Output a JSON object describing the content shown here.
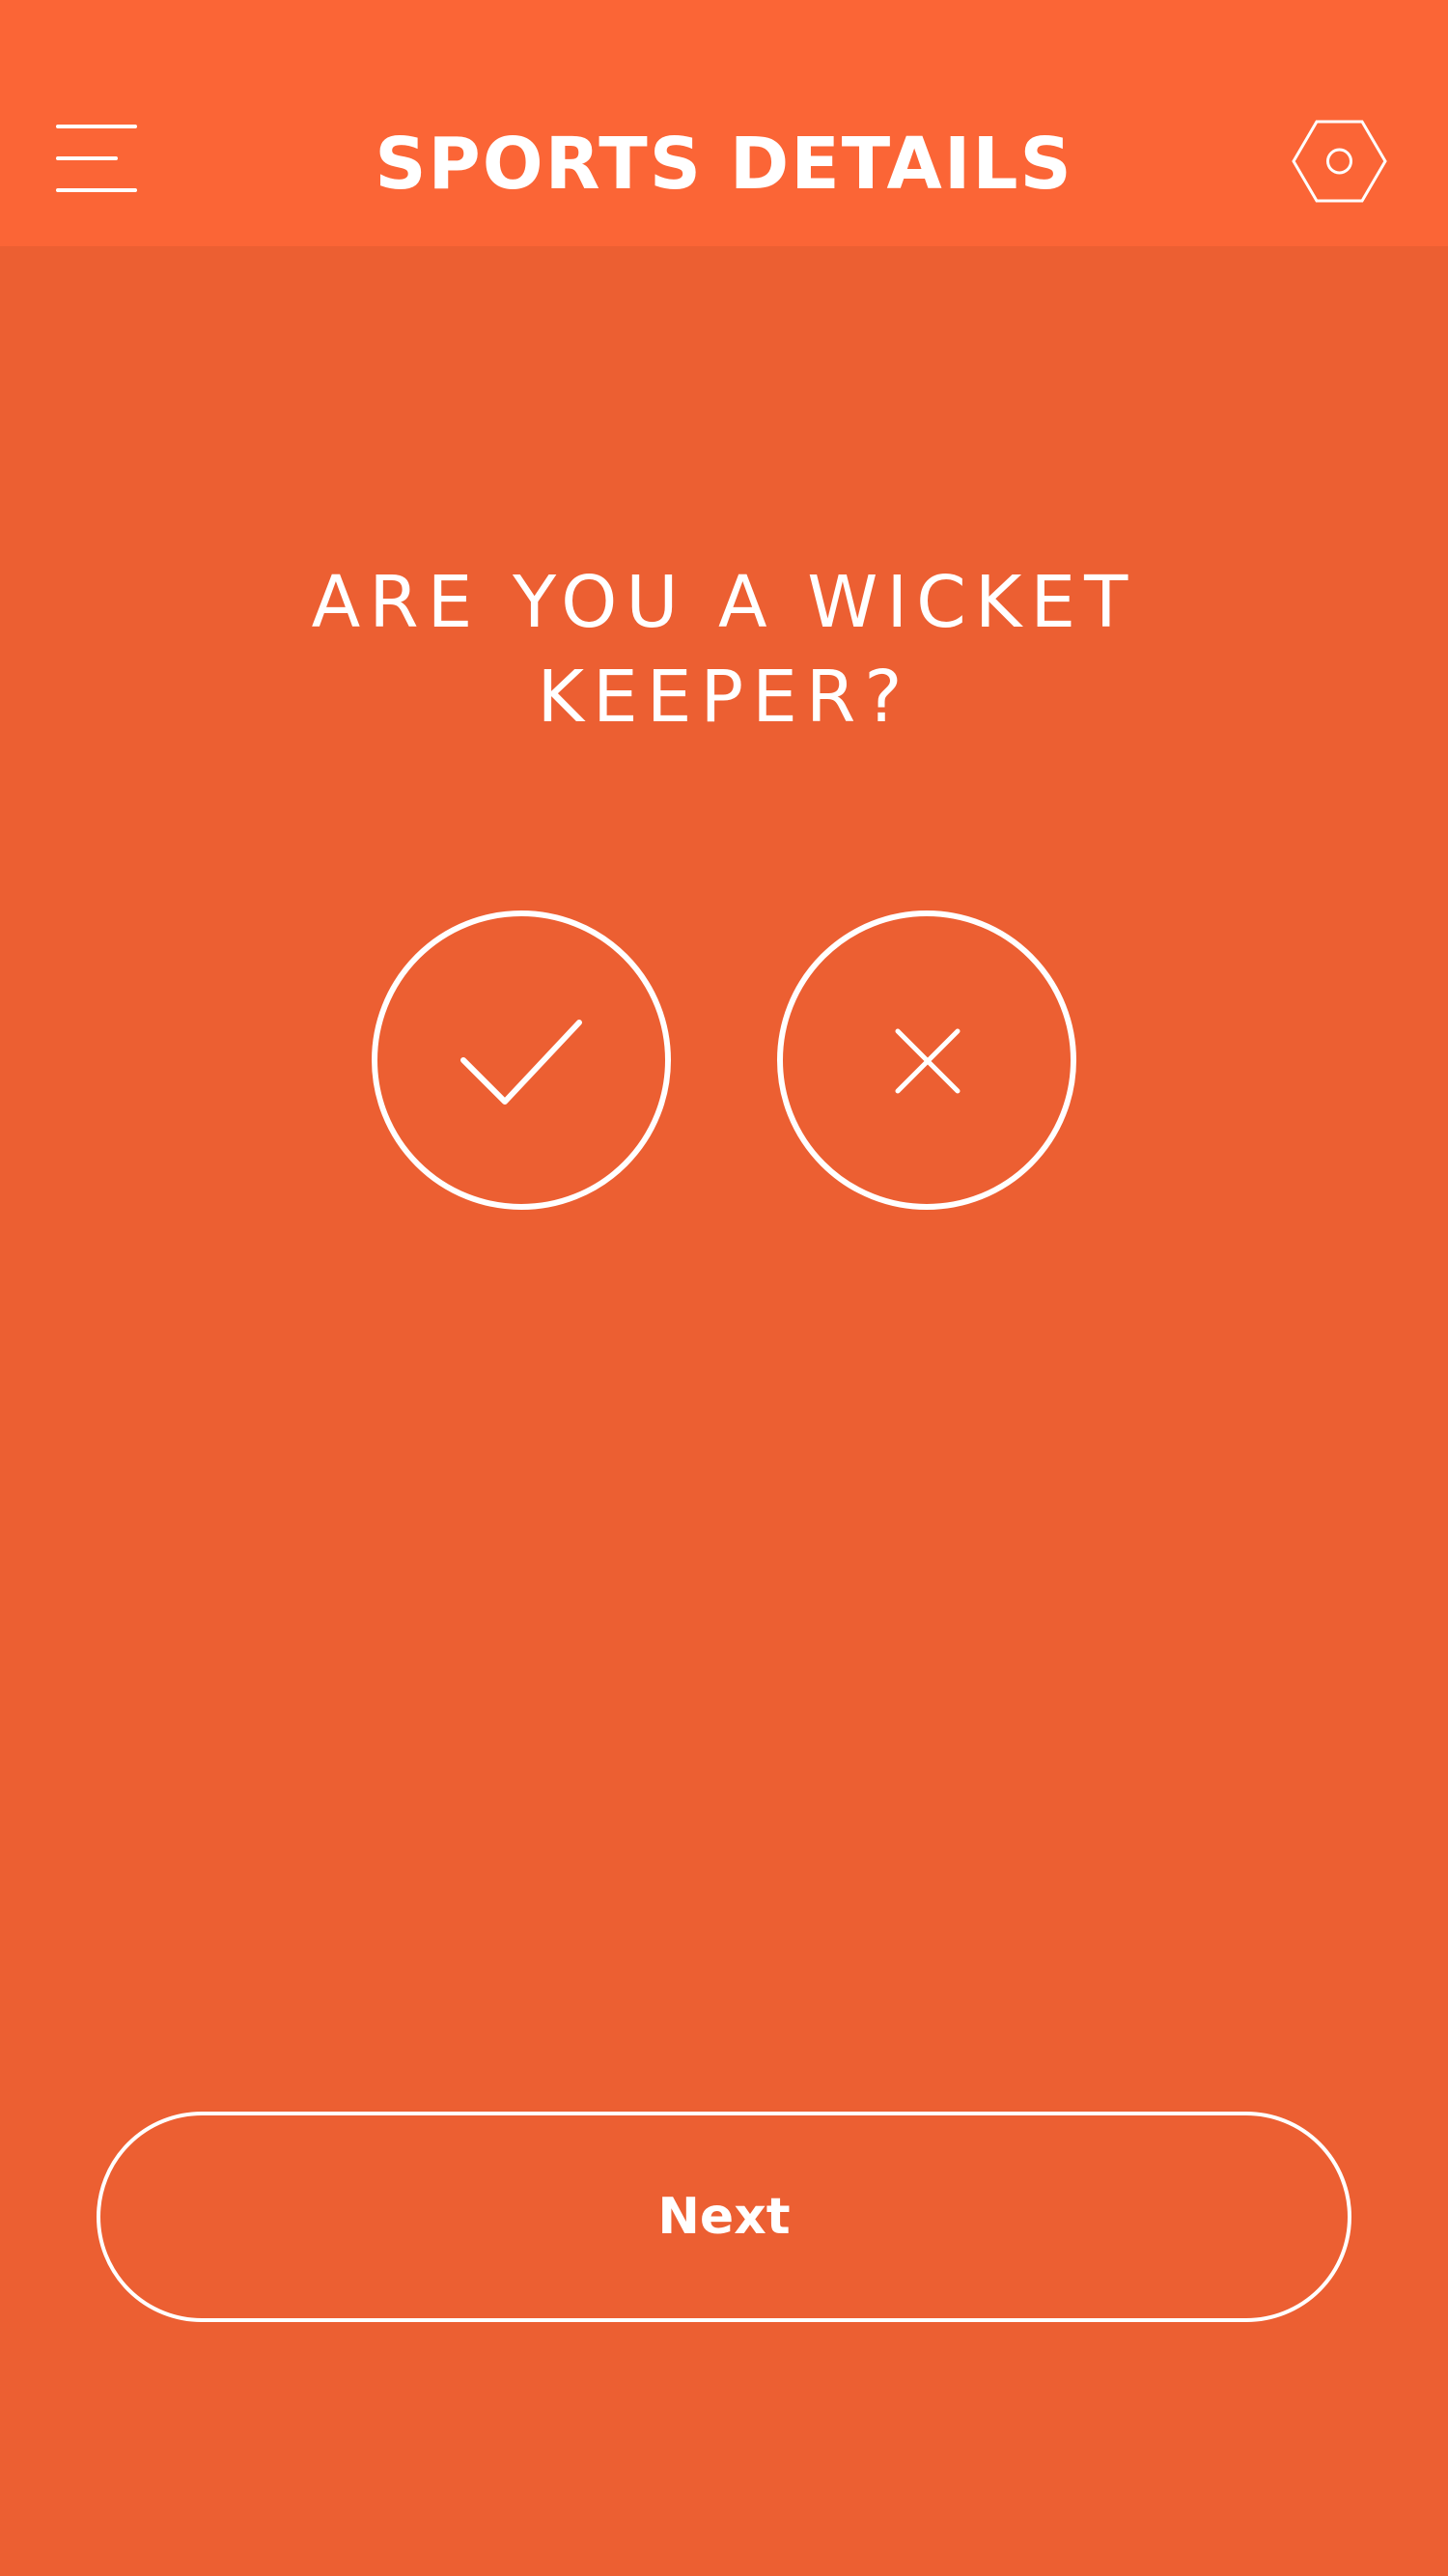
{
  "header": {
    "title": "SPORTS DETAILS",
    "menu_icon": "hamburger-menu-icon",
    "settings_icon": "hexagon-settings-icon",
    "background_color": "#fb6536"
  },
  "main": {
    "question": "ARE YOU A WICKET KEEPER?",
    "yes_icon": "checkmark-icon",
    "no_icon": "close-x-icon",
    "background_color": "#ec5f32"
  },
  "footer": {
    "next_label": "Next"
  }
}
